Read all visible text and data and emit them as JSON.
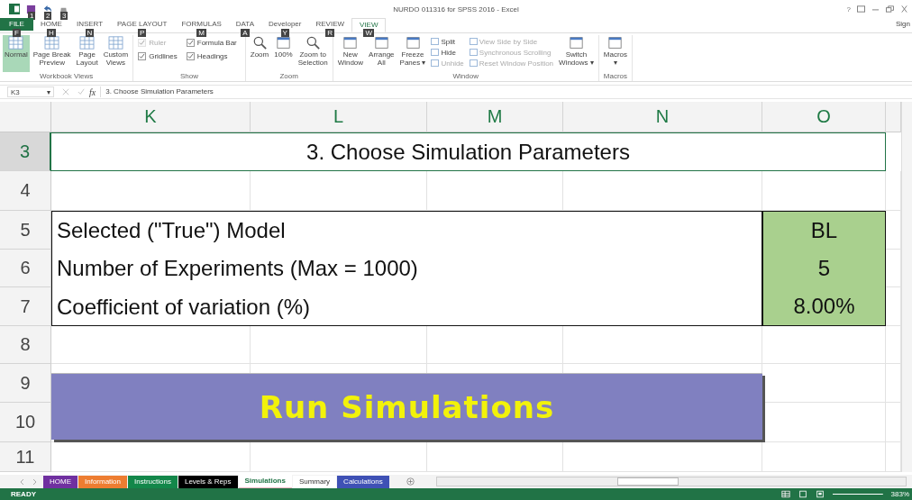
{
  "quick_access": {
    "keytips": [
      "1",
      "2",
      "3"
    ]
  },
  "window": {
    "title": "NURDO 011316 for SPSS 2016 - Excel",
    "help": "?",
    "account": "Sign"
  },
  "tabs": [
    {
      "label": "FILE",
      "keytip": "F",
      "selected": false,
      "kind": "file"
    },
    {
      "label": "HOME",
      "keytip": "H",
      "selected": false,
      "kind": "tab"
    },
    {
      "label": "INSERT",
      "keytip": "N",
      "selected": false,
      "kind": "tab"
    },
    {
      "label": "PAGE LAYOUT",
      "keytip": "P",
      "selected": false,
      "kind": "tab"
    },
    {
      "label": "FORMULAS",
      "keytip": "M",
      "selected": false,
      "kind": "tab"
    },
    {
      "label": "DATA",
      "keytip": "A",
      "selected": false,
      "kind": "tab"
    },
    {
      "label": "Developer",
      "keytip": "Y",
      "selected": false,
      "kind": "tab"
    },
    {
      "label": "REVIEW",
      "keytip": "R",
      "selected": false,
      "kind": "tab"
    },
    {
      "label": "VIEW",
      "keytip": "W",
      "selected": true,
      "kind": "tab"
    }
  ],
  "ribbon": [
    {
      "label": "Workbook Views",
      "columns": [
        {
          "items": [
            {
              "kind": "large",
              "lines": [
                "Normal"
              ],
              "selected": true
            }
          ]
        },
        {
          "items": [
            {
              "kind": "large",
              "lines": [
                "Page Break",
                "Preview"
              ],
              "selected": false
            }
          ]
        },
        {
          "items": [
            {
              "kind": "large",
              "lines": [
                "Page",
                "Layout"
              ],
              "selected": false
            }
          ]
        },
        {
          "items": [
            {
              "kind": "large",
              "lines": [
                "Custom",
                "Views"
              ],
              "selected": false
            }
          ]
        }
      ]
    },
    {
      "label": "Show",
      "columns": [
        {
          "items": [
            {
              "kind": "check",
              "lines": [
                "Ruler"
              ],
              "checked": true,
              "disabled": true
            },
            {
              "kind": "check",
              "lines": [
                "Gridlines"
              ],
              "checked": true,
              "disabled": false
            }
          ]
        },
        {
          "items": [
            {
              "kind": "check",
              "lines": [
                "Formula Bar"
              ],
              "checked": true,
              "disabled": false
            },
            {
              "kind": "check",
              "lines": [
                "Headings"
              ],
              "checked": true,
              "disabled": false
            }
          ]
        }
      ]
    },
    {
      "label": "Zoom",
      "columns": [
        {
          "items": [
            {
              "kind": "large",
              "lines": [
                "Zoom"
              ],
              "selected": false
            }
          ]
        },
        {
          "items": [
            {
              "kind": "large",
              "lines": [
                "100%"
              ],
              "selected": false
            }
          ]
        },
        {
          "items": [
            {
              "kind": "large",
              "lines": [
                "Zoom to",
                "Selection"
              ],
              "selected": false
            }
          ]
        }
      ]
    },
    {
      "label": "Window",
      "columns": [
        {
          "items": [
            {
              "kind": "large",
              "lines": [
                "New",
                "Window"
              ],
              "selected": false
            }
          ]
        },
        {
          "items": [
            {
              "kind": "large",
              "lines": [
                "Arrange",
                "All"
              ],
              "selected": false
            }
          ]
        },
        {
          "items": [
            {
              "kind": "large",
              "lines": [
                "Freeze",
                "Panes ▾"
              ],
              "selected": false
            }
          ]
        },
        {
          "items": [
            {
              "kind": "small",
              "lines": [
                "Split"
              ],
              "disabled": false
            },
            {
              "kind": "small",
              "lines": [
                "Hide"
              ],
              "disabled": false
            },
            {
              "kind": "small",
              "lines": [
                "Unhide"
              ],
              "disabled": true
            }
          ]
        },
        {
          "items": [
            {
              "kind": "small",
              "lines": [
                "View Side by Side"
              ],
              "disabled": true
            },
            {
              "kind": "small",
              "lines": [
                "Synchronous Scrolling"
              ],
              "disabled": true
            },
            {
              "kind": "small",
              "lines": [
                "Reset Window Position"
              ],
              "disabled": true
            }
          ]
        },
        {
          "items": [
            {
              "kind": "large",
              "lines": [
                "Switch",
                "Windows ▾"
              ],
              "selected": false
            }
          ]
        }
      ]
    },
    {
      "label": "Macros",
      "columns": [
        {
          "items": [
            {
              "kind": "large",
              "lines": [
                "Macros",
                "▾"
              ],
              "selected": false
            }
          ]
        }
      ]
    }
  ],
  "formula_bar": {
    "name_box": "K3",
    "dropdown": "▾",
    "fx": "fx",
    "value": "3. Choose Simulation Parameters"
  },
  "columns": [
    "K",
    "L",
    "M",
    "N",
    "O"
  ],
  "rows": [
    "3",
    "4",
    "5",
    "6",
    "7",
    "8",
    "9",
    "10",
    "11"
  ],
  "sheet": {
    "title": "3. Choose Simulation Parameters",
    "parameters": [
      {
        "label": "Selected (\"True\") Model",
        "value": "BL"
      },
      {
        "label": "Number of Experiments (Max = 1000)",
        "value": "5"
      },
      {
        "label": "Coefficient of variation (%)",
        "value": "8.00%"
      }
    ],
    "run_button": "Run Simulations"
  },
  "sheet_tabs": [
    {
      "label": "HOME",
      "color": "#7030a0",
      "selected": false
    },
    {
      "label": "Information",
      "color": "#ed7d31",
      "selected": false
    },
    {
      "label": "Instructions",
      "color": "#13874a",
      "selected": false
    },
    {
      "label": "Levels & Reps",
      "color": "#000000",
      "selected": false
    },
    {
      "label": "Simulations",
      "color": "#f4b6c2",
      "selected": true
    },
    {
      "label": "Summary",
      "color": "#ffffff",
      "selected": false
    },
    {
      "label": "Calculations",
      "color": "#3f51b5",
      "selected": false
    }
  ],
  "status_bar": {
    "mode": "READY",
    "zoom": "383%",
    "zoom_slider": {
      "level": 0.95
    }
  }
}
